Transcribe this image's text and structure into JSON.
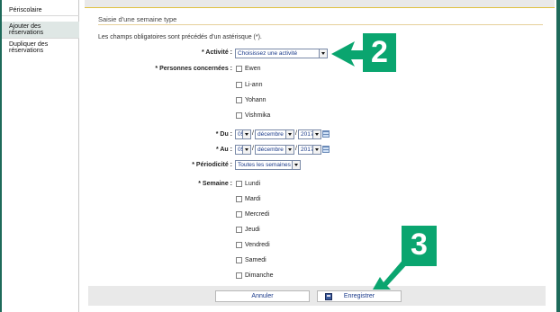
{
  "sidebar": {
    "items": [
      {
        "label": "Périscolaire"
      },
      {
        "label": "Ajouter des réservations"
      },
      {
        "label": "Dupliquer des réservations"
      }
    ]
  },
  "form": {
    "title": "Saisie d'une semaine type",
    "intro": "Les champs obligatoires sont précédés d'un astérisque (*).",
    "activite": {
      "label": "* Activité :",
      "value": "Choisissez une activité"
    },
    "personnes": {
      "label": "* Personnes concernées :",
      "options": [
        "Ewen",
        "Li-ann",
        "Yohann",
        "Vishmika"
      ]
    },
    "du": {
      "label": "* Du :",
      "day": "05",
      "month": "décembre",
      "year": "2017"
    },
    "au": {
      "label": "* Au :",
      "day": "05",
      "month": "décembre",
      "year": "2017"
    },
    "periodicite": {
      "label": "* Périodicité :",
      "value": "Toutes les semaines"
    },
    "semaine": {
      "label": "* Semaine :",
      "days": [
        "Lundi",
        "Mardi",
        "Mercredi",
        "Jeudi",
        "Vendredi",
        "Samedi",
        "Dimanche"
      ]
    }
  },
  "buttons": {
    "cancel": "Annuler",
    "save": "Enregistrer"
  },
  "callouts": {
    "two": "2",
    "three": "3"
  },
  "colors": {
    "callout": "#0aa56f",
    "frame": "#1e6a5a",
    "link": "#1a3a8a"
  },
  "icons": {
    "calendar": "calendar-icon",
    "save": "save-icon",
    "arrow": "arrow-icon"
  }
}
